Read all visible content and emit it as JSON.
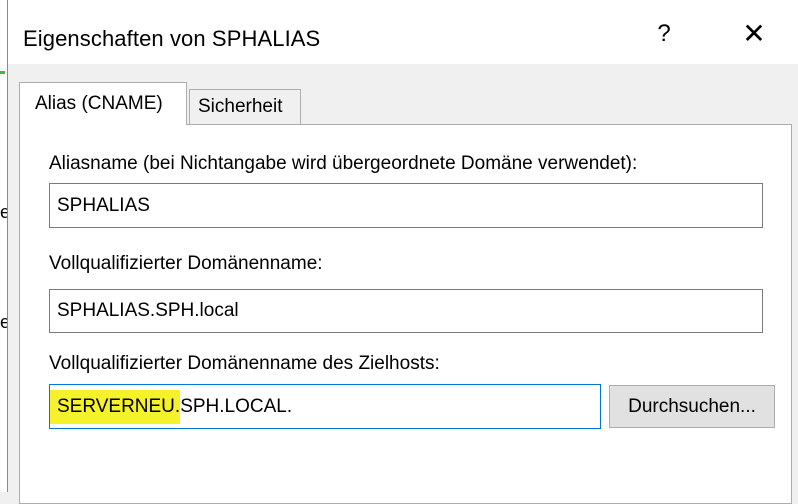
{
  "dialog": {
    "title": "Eigenschaften von SPHALIAS",
    "help_label": "?",
    "close_label": "✕"
  },
  "background": {
    "chars": [
      "e",
      "e"
    ]
  },
  "tabs": [
    {
      "label": "Alias (CNAME)",
      "active": true
    },
    {
      "label": "Sicherheit",
      "active": false
    }
  ],
  "form": {
    "alias_label": "Aliasname (bei Nichtangabe wird übergeordnete Domäne verwendet):",
    "alias_value": "SPHALIAS",
    "fqdn_label": "Vollqualifizierter Domänenname:",
    "fqdn_value": "SPHALIAS.SPH.local",
    "target_label": "Vollqualifizierter Domänenname des Zielhosts:",
    "target_value_highlight": "SERVERNEU.",
    "target_value_rest": "SPH.LOCAL.",
    "browse_label": "Durchsuchen..."
  },
  "colors": {
    "highlight": "#f5f12a",
    "focus_border": "#0078d7"
  }
}
